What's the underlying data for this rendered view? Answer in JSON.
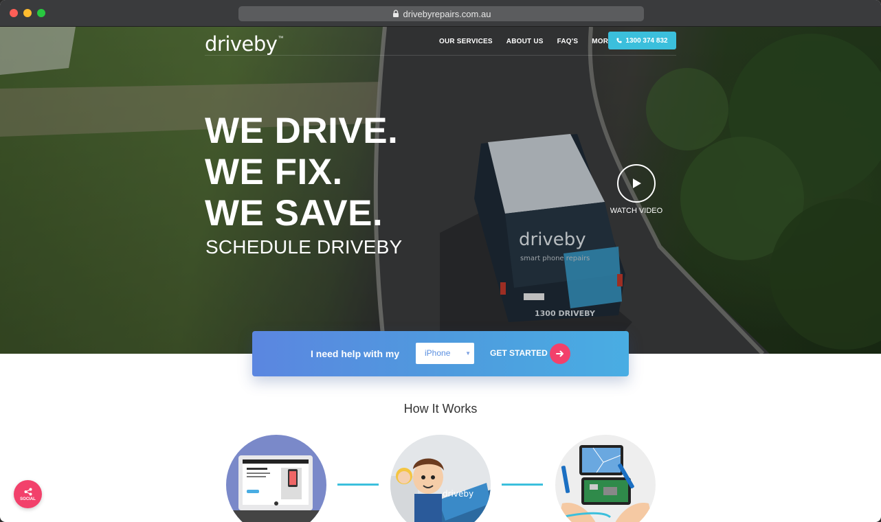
{
  "browser": {
    "url": "drivebyrepairs.com.au"
  },
  "header": {
    "logo": "driveby",
    "logo_tm": "™",
    "nav": [
      "OUR SERVICES",
      "ABOUT US",
      "FAQ'S",
      "MORE"
    ],
    "phone": "1300 374 832"
  },
  "hero": {
    "line1": "WE DRIVE.",
    "line2": "WE FIX.",
    "line3": "WE SAVE.",
    "subhead": "SCHEDULE DRIVEBY",
    "watch_video": "WATCH VIDEO",
    "van_logo": "driveby",
    "van_tagline": "smart phone repairs",
    "van_phone": "1300 DRIVEBY"
  },
  "help": {
    "label": "I need help with my",
    "selected_device": "iPhone",
    "cta": "GET STARTED"
  },
  "how_it_works": {
    "title": "How It Works",
    "van_logo": "driveby"
  },
  "social": {
    "label": "SOCIAL"
  },
  "colors": {
    "accent_blue": "#3bbfdc",
    "accent_pink": "#f2416b"
  }
}
